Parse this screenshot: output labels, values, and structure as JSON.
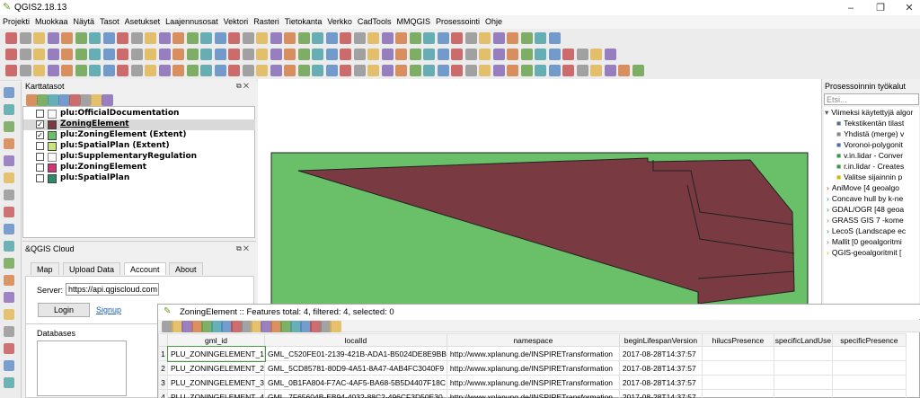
{
  "window": {
    "title": "QGIS2.18.13"
  },
  "menu": [
    "Projekti",
    "Muokkaa",
    "Näytä",
    "Tasot",
    "Asetukset",
    "Laajennusosat",
    "Vektori",
    "Rasteri",
    "Tietokanta",
    "Verkko",
    "CadTools",
    "MMQGIS",
    "Prosessointi",
    "Ohje"
  ],
  "layers_panel": {
    "title": "Karttatasot",
    "layers": [
      {
        "name": "plu:OfficialDocumentation",
        "checked": false,
        "color": "",
        "selected": false
      },
      {
        "name": "ZoningElement",
        "checked": true,
        "color": "#7a3a42",
        "selected": true
      },
      {
        "name": "plu:ZoningElement (Extent)",
        "checked": true,
        "color": "#6abf69",
        "selected": false
      },
      {
        "name": "plu:SpatialPlan (Extent)",
        "checked": false,
        "color": "#c8e67a",
        "selected": false
      },
      {
        "name": "plu:SupplementaryRegulation",
        "checked": false,
        "color": "",
        "selected": false
      },
      {
        "name": "plu:ZoningElement",
        "checked": false,
        "color": "#d0357a",
        "selected": false
      },
      {
        "name": "plu:SpatialPlan",
        "checked": false,
        "color": "#2e8b6a",
        "selected": false
      }
    ]
  },
  "cloud_panel": {
    "title": "&QGIS Cloud",
    "tabs": [
      "Map",
      "Upload Data",
      "Account",
      "About"
    ],
    "active_tab": "Account",
    "server_label": "Server:",
    "server_value": "https://api.qgiscloud.com",
    "login_label": "Login",
    "signup_label": "Signup",
    "databases_label": "Databases"
  },
  "processing_panel": {
    "title": "Prosessoinnin työkalut",
    "search_placeholder": "Etsi...",
    "recent_label": "Viimeksi käytettyjä algor",
    "recent_items": [
      "Tekstikentän tilast",
      "Yhdistä (merge) v",
      "Voronoi-polygonit",
      "v.in.lidar - Conver",
      "r.in.lidar - Creates",
      "Valitse sijainnin p"
    ],
    "providers": [
      "AniMove [4 geoalgo",
      "Concave hull by k-ne",
      "GDAL/OGR [48 geoa",
      "GRASS GIS 7 -kome",
      "LecoS (Landscape ec",
      "Mallit [0 geoalgoritmi",
      "QGIS-geoalgoritmit ["
    ]
  },
  "attribute_table": {
    "title": "ZoningElement :: Features total: 4, filtered: 4, selected: 0",
    "columns": [
      "gml_id",
      "localId",
      "namespace",
      "beginLifespanVersion",
      "hilucsPresence",
      "specificLandUse",
      "specificPresence"
    ],
    "rows": [
      {
        "n": "1",
        "cells": [
          "PLU_ZONINGELEMENT_1",
          "GML_C520FE01-2139-421B-ADA1-B5024DE8E9BB",
          "http://www.xplanung.de/INSPIRETransformation",
          "2017-08-28T14:37:57",
          "",
          "",
          ""
        ]
      },
      {
        "n": "2",
        "cells": [
          "PLU_ZONINGELEMENT_2",
          "GML_5CD85781-80D9-4A51-8A47-4AB4FC3040F9",
          "http://www.xplanung.de/INSPIRETransformation",
          "2017-08-28T14:37:57",
          "",
          "",
          ""
        ]
      },
      {
        "n": "3",
        "cells": [
          "PLU_ZONINGELEMENT_3",
          "GML_0B1FA804-F7AC-4AF5-BA68-5B5D4407F18C",
          "http://www.xplanung.de/INSPIRETransformation",
          "2017-08-28T14:37:57",
          "",
          "",
          ""
        ]
      },
      {
        "n": "4",
        "cells": [
          "PLU_ZONINGELEMENT_4",
          "GML_7F65604B-EB94-4032-88C2-496CF3D50E30",
          "http://www.xplanung.de/INSPIRETransformation",
          "2017-08-28T14:37:57",
          "",
          "",
          ""
        ]
      }
    ]
  },
  "colors": {
    "zoning_fill": "#7a3a42",
    "extent_fill": "#6abf69",
    "accent": "#3a78c8"
  }
}
